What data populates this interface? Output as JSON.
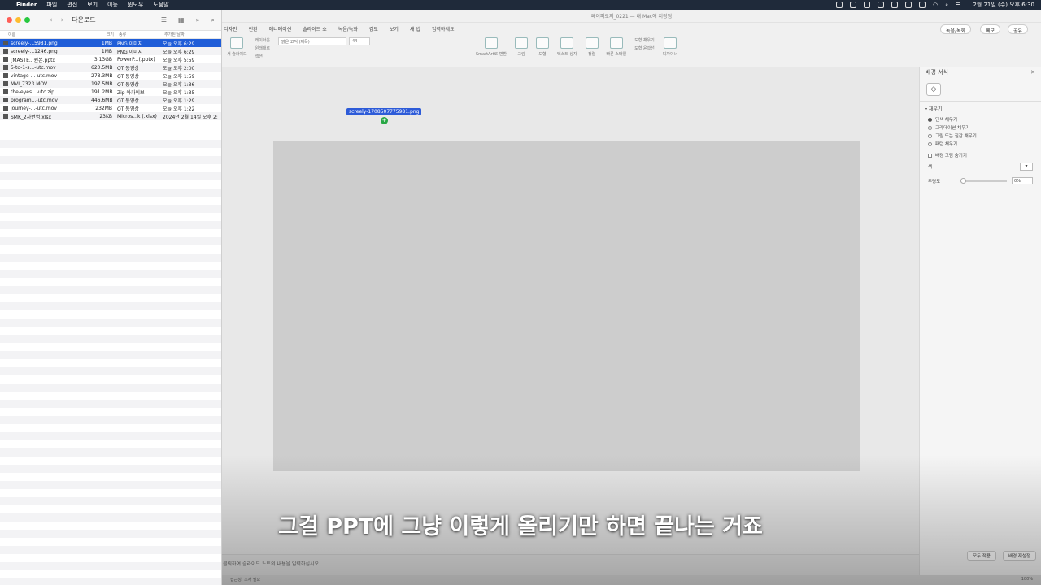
{
  "menubar": {
    "app": "Finder",
    "items": [
      "파일",
      "편집",
      "보기",
      "이동",
      "윈도우",
      "도움말"
    ],
    "clock": "2월 21일 (수) 오후 6:30"
  },
  "finder": {
    "title": "다운로드",
    "columns": {
      "name": "이름",
      "size": "크기",
      "kind": "종류",
      "date": "추가된 날짜"
    },
    "files": [
      {
        "name": "screely-...5981.png",
        "size": "1MB",
        "kind": "PNG 이미지",
        "date": "오늘 오후 6:29",
        "selected": true
      },
      {
        "name": "screely-...1246.png",
        "size": "1MB",
        "kind": "PNG 이미지",
        "date": "오늘 오후 6:29"
      },
      {
        "name": "[MASTE...원본.pptx",
        "size": "3.13GB",
        "kind": "PowerP...(.pptx)",
        "date": "오늘 오후 5:59"
      },
      {
        "name": "5-to-1-s...-utc.mov",
        "size": "620.5MB",
        "kind": "QT 동영상",
        "date": "오늘 오후 2:00"
      },
      {
        "name": "vintage-...-utc.mov",
        "size": "278.3MB",
        "kind": "QT 동영상",
        "date": "오늘 오후 1:59"
      },
      {
        "name": "MVI_7323.MOV",
        "size": "197.5MB",
        "kind": "QT 동영상",
        "date": "오늘 오후 1:36"
      },
      {
        "name": "the-eyes...-utc.zip",
        "size": "191.2MB",
        "kind": "Zip 아카이브",
        "date": "오늘 오후 1:35"
      },
      {
        "name": "program...-utc.mov",
        "size": "446.6MB",
        "kind": "QT 동영상",
        "date": "오늘 오후 1:29"
      },
      {
        "name": "journey-...-utc.mov",
        "size": "232MB",
        "kind": "QT 동영상",
        "date": "오늘 오후 1:22"
      },
      {
        "name": "SMK_2차번역.xlsx",
        "size": "23KB",
        "kind": "Micros...k (.xlsx)",
        "date": "2024년 2월 14일 오후 2:43"
      }
    ]
  },
  "ppt": {
    "doc_title": "페이퍼로지_0221 — 내 Mac에 저장됨",
    "tabs": [
      "디자인",
      "전환",
      "애니메이션",
      "슬라이드 쇼",
      "녹음/녹화",
      "검토",
      "보기",
      "새 법",
      "입력하세요"
    ],
    "record_btn": "녹음/녹화",
    "memo_btn": "메모",
    "share_btn": "공유",
    "font_name": "맑은 고딕 (제목)",
    "font_size": "44",
    "ribbon_labels": [
      "새 슬라이드",
      "레이아웃",
      "원래대로",
      "섹션",
      "SmartArt로 변환",
      "그림",
      "도형",
      "텍스트 상자",
      "정렬",
      "빠른 스타일",
      "도형 채우기",
      "도형 윤곽선",
      "디자이너"
    ],
    "drag_filename": "screely-1708507775981.png",
    "notes_placeholder": "클릭하여 슬라이드 노트의 내용을 입력하십시오",
    "status_left": "접근성: 조사 필요",
    "zoom": "100%"
  },
  "pane": {
    "title": "배경 서식",
    "section": "채우기",
    "options": [
      "단색 채우기",
      "그라데이션 채우기",
      "그림 또는 질감 채우기",
      "패턴 채우기"
    ],
    "hide_bg": "배경 그림 숨기기",
    "color_label": "색",
    "transparency_label": "투명도",
    "transparency_value": "0%",
    "apply_all": "모두 적용",
    "reset_bg": "배경 재설정"
  },
  "subtitle": "그걸 PPT에 그냥 이렇게 올리기만 하면 끝나는 거죠"
}
